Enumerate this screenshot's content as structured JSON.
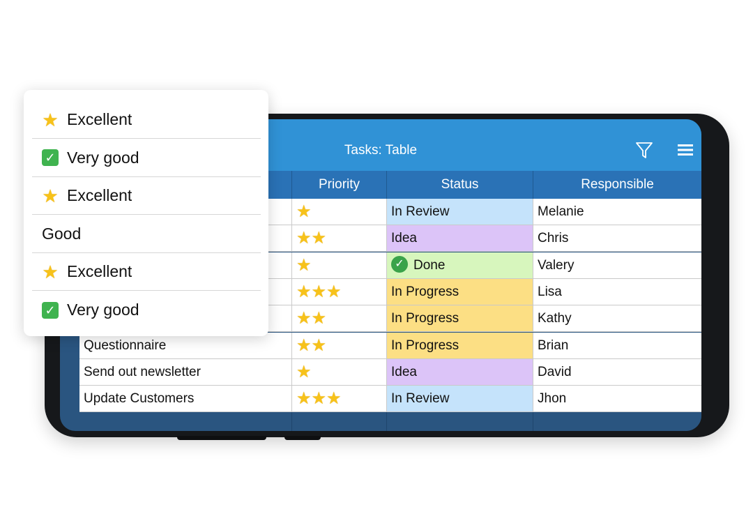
{
  "app": {
    "title": "Tasks: Table",
    "filter_icon": "filter-icon",
    "menu_icon": "menu-icon"
  },
  "table": {
    "columns": [
      "",
      "Priority",
      "Status",
      "Responsible"
    ],
    "rows": [
      {
        "task": "",
        "priority": 1,
        "stars": "★",
        "status": "In Review",
        "status_color": "#c5e3fb",
        "status_icon": "",
        "responsible": "Melanie"
      },
      {
        "task": "",
        "priority": 2,
        "stars": "★★",
        "status": "Idea",
        "status_color": "#dcc4f8",
        "status_icon": "",
        "responsible": "Chris"
      },
      {
        "task": "",
        "priority": 1,
        "stars": "★",
        "status": "Done",
        "status_color": "#d7f6bd",
        "status_icon": "✓",
        "responsible": "Valery"
      },
      {
        "task": "",
        "priority": 3,
        "stars": "★★★",
        "status": "In Progress",
        "status_color": "#fcdf84",
        "status_icon": "",
        "responsible": "Lisa"
      },
      {
        "task": "",
        "priority": 2,
        "stars": "★★",
        "status": "In Progress",
        "status_color": "#fcdf84",
        "status_icon": "",
        "responsible": "Kathy"
      },
      {
        "task": "Questionnaire",
        "priority": 2,
        "stars": "★★",
        "status": "In Progress",
        "status_color": "#fcdf84",
        "status_icon": "",
        "responsible": "Brian"
      },
      {
        "task": "Send out newsletter",
        "priority": 1,
        "stars": "★",
        "status": "Idea",
        "status_color": "#dcc4f8",
        "status_icon": "",
        "responsible": "David"
      },
      {
        "task": "Update Customers",
        "priority": 3,
        "stars": "★★★",
        "status": "In Review",
        "status_color": "#c5e3fb",
        "status_icon": "",
        "responsible": "Jhon"
      }
    ]
  },
  "popup": {
    "items": [
      {
        "icon": "star-icon",
        "glyph": "★",
        "label": "Excellent"
      },
      {
        "icon": "check-box-icon",
        "glyph": "✓",
        "label": "Very good"
      },
      {
        "icon": "star-icon",
        "glyph": "★",
        "label": "Excellent"
      },
      {
        "icon": "",
        "glyph": "",
        "label": "Good"
      },
      {
        "icon": "star-icon",
        "glyph": "★",
        "label": "Excellent"
      },
      {
        "icon": "check-box-icon",
        "glyph": "✓",
        "label": "Very good"
      }
    ]
  },
  "colors": {
    "header_blue": "#3092d6",
    "column_header_blue": "#2a72b6",
    "status_in_review": "#c5e3fb",
    "status_idea": "#dcc4f8",
    "status_done": "#d7f6bd",
    "status_in_progress": "#fcdf84",
    "star_yellow": "#f7c21a",
    "check_green": "#3fb34f"
  }
}
